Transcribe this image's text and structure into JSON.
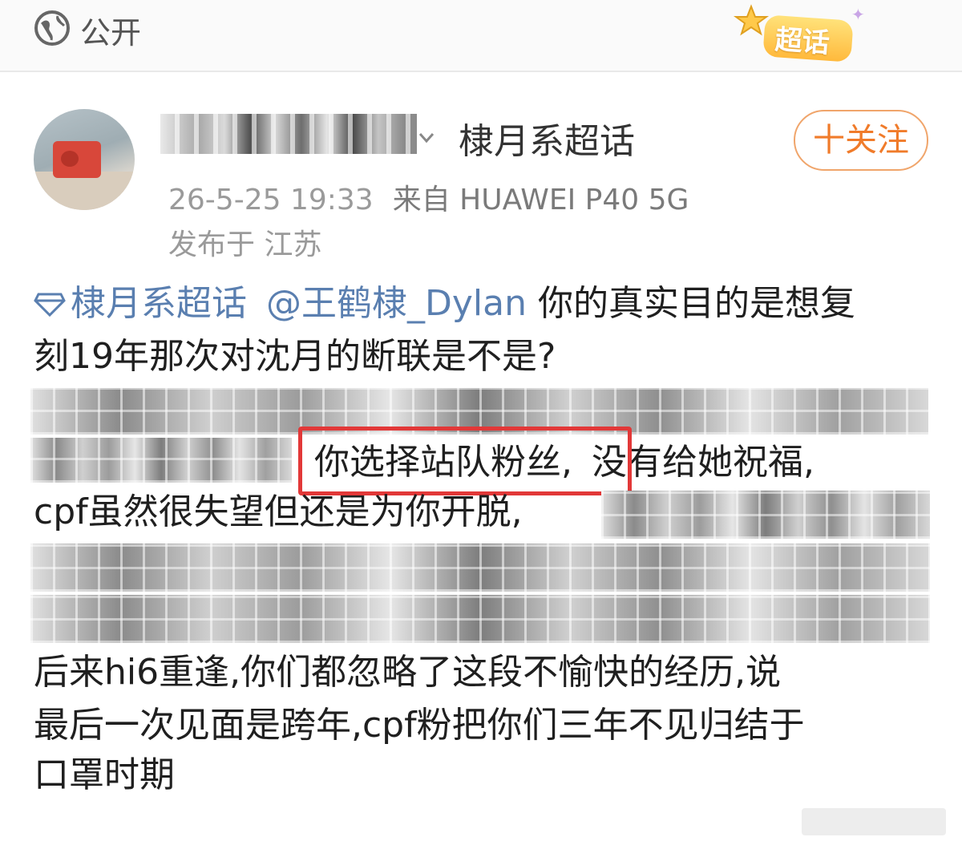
{
  "visibility": {
    "label": "公开",
    "icon": "globe-icon"
  },
  "super_topic_badge": {
    "label": "超话",
    "colors": {
      "fill": "#ffc94a",
      "text": "#ffffff"
    }
  },
  "author": {
    "name_suffix": "棣月系超话",
    "follow_label": "十关注",
    "timestamp": "26-5-25 19:33",
    "source": "来自 HUAWEI P40 5G",
    "location": "发布于 江苏"
  },
  "post": {
    "topic_tag": "棣月系超话",
    "mention": "@王鹤棣_Dylan",
    "line1_rest": " 你的真实目的是想复",
    "line2": "刻19年那次对沈月的断联是不是?",
    "highlight_phrase": "你选择站队粉丝,",
    "line4_rest": "没有给她祝福,",
    "line5_visible": "cpf虽然很失望但还是为你开脱,",
    "line8": "后来hi6重逢,你们都忽略了这段不愉快的经历,说",
    "line9": "最后一次见面是跨年,cpf粉把你们三年不见归结于",
    "line10": "口罩时期"
  },
  "colors": {
    "link": "#5a7fb0",
    "follow": "#f07b2a",
    "highlight_box": "#e23838",
    "meta": "#9a9a9a"
  }
}
